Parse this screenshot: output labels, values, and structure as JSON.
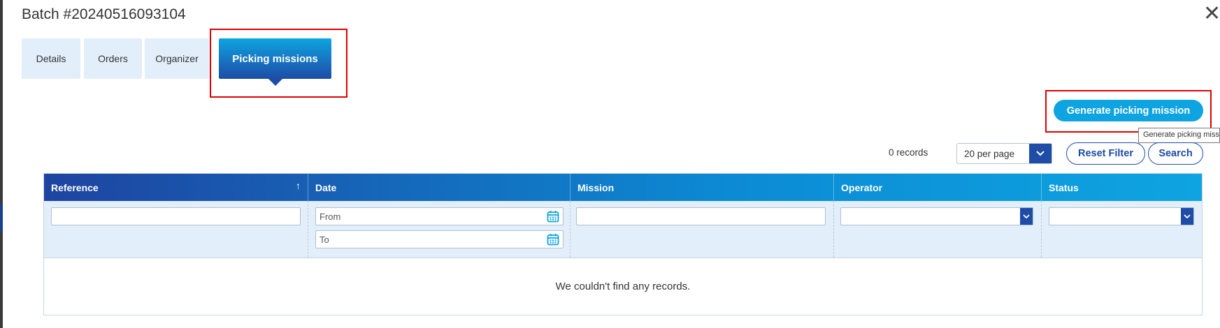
{
  "header": {
    "title": "Batch #20240516093104",
    "close_glyph": "✕"
  },
  "tabs": [
    {
      "label": "Details",
      "active": false
    },
    {
      "label": "Orders",
      "active": false
    },
    {
      "label": "Organizer",
      "active": false
    },
    {
      "label": "Picking missions",
      "active": true
    }
  ],
  "actions": {
    "generate_label": "Generate picking mission",
    "generate_tooltip": "Generate picking mission"
  },
  "toolbar": {
    "records": "0 records",
    "per_page": "20 per page",
    "reset_label": "Reset Filter",
    "search_label": "Search"
  },
  "table": {
    "columns": [
      "Reference",
      "Date",
      "Mission",
      "Operator",
      "Status"
    ],
    "sort_glyph": "↑",
    "filters": {
      "date_from_placeholder": "From",
      "date_to_placeholder": "To"
    },
    "empty_message": "We couldn't find any records."
  },
  "colors": {
    "accent": "#0ea4e1",
    "primary": "#1e4ca6",
    "highlight": "#e00000",
    "tab_bg": "#e3eefb"
  }
}
